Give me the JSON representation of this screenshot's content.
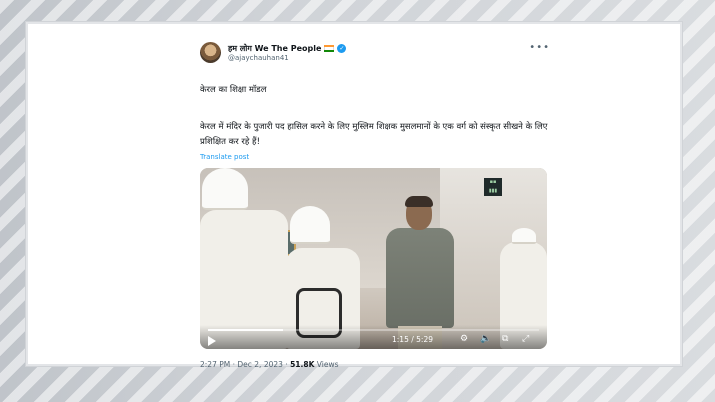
{
  "tweet": {
    "display_name": "हम लोग We The People",
    "handle": "@ajaychauhan41",
    "more_icon": "more-dots-icon",
    "text_line1": "केरल का शिक्षा मॉडल",
    "text_body": "केरल में मंदिर के पुजारी पद हासिल करने के लिए मुस्लिम शिक्षक मुसलमानों के एक वर्ग को संस्कृत सीखने के लिए प्रशिक्षित कर रहे हैं!",
    "translate_label": "Translate post",
    "flag_colors": [
      "#ff9933",
      "#ffffff",
      "#138808"
    ],
    "verified_color": "#1d9bf0"
  },
  "video": {
    "current_time": "1:15",
    "separator": " / ",
    "duration": "5:29",
    "progress": 0.228,
    "icons": [
      "play-icon",
      "settings-icon",
      "volume-icon",
      "pip-icon",
      "fullscreen-icon"
    ]
  },
  "meta": {
    "time": "2:27 PM",
    "dot1": " · ",
    "date": "Dec 2, 2023",
    "dot2": " · ",
    "views_count": "51.8K",
    "views_label": " Views"
  }
}
